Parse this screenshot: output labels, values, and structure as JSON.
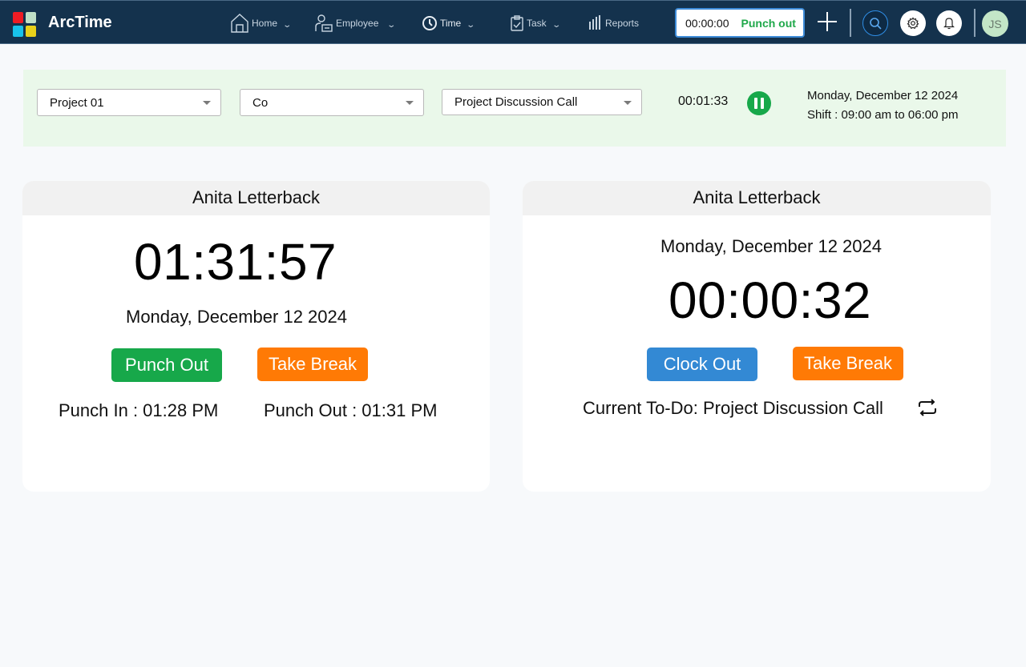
{
  "app": {
    "brand": "ArcTime"
  },
  "nav": {
    "items": [
      {
        "label": "Home",
        "icon": "home-icon",
        "dropdown": true
      },
      {
        "label": "Employee",
        "icon": "employee-icon",
        "dropdown": true
      },
      {
        "label": "Time",
        "icon": "clock-icon",
        "dropdown": true
      },
      {
        "label": "Task",
        "icon": "clipboard-check-icon",
        "dropdown": true
      },
      {
        "label": "Reports",
        "icon": "bar-chart-icon",
        "dropdown": false
      }
    ],
    "punch_widget": {
      "time": "00:00:00",
      "action": "Punch out"
    },
    "add_label": "+",
    "avatar_initials": "JS"
  },
  "filterbar": {
    "project_select": "Project 01",
    "task_select": "Co",
    "todo_select": "Project Discussion Call",
    "timer": "00:01:33",
    "date": "Monday, December 12 2024",
    "shift": "Shift : 09:00 am to 06:00 pm"
  },
  "cards": {
    "left": {
      "employee": "Anita Letterback",
      "elapsed": "01:31:57",
      "date": "Monday, December 12 2024",
      "primary_button": "Punch Out",
      "secondary_button": "Take Break",
      "punch_in": "Punch In : 01:28 PM",
      "punch_out": "Punch Out : 01:31 PM"
    },
    "right": {
      "employee": "Anita Letterback",
      "date": "Monday, December 12 2024",
      "elapsed": "00:00:32",
      "primary_button": "Clock Out",
      "secondary_button": "Take Break",
      "current_todo": "Current To-Do: Project Discussion Call"
    }
  },
  "colors": {
    "nav_bg": "#14324d",
    "accent_green": "#17a84a",
    "accent_orange": "#ff7a05",
    "accent_blue": "#3389d4",
    "filter_bg": "#eaf8ea"
  }
}
